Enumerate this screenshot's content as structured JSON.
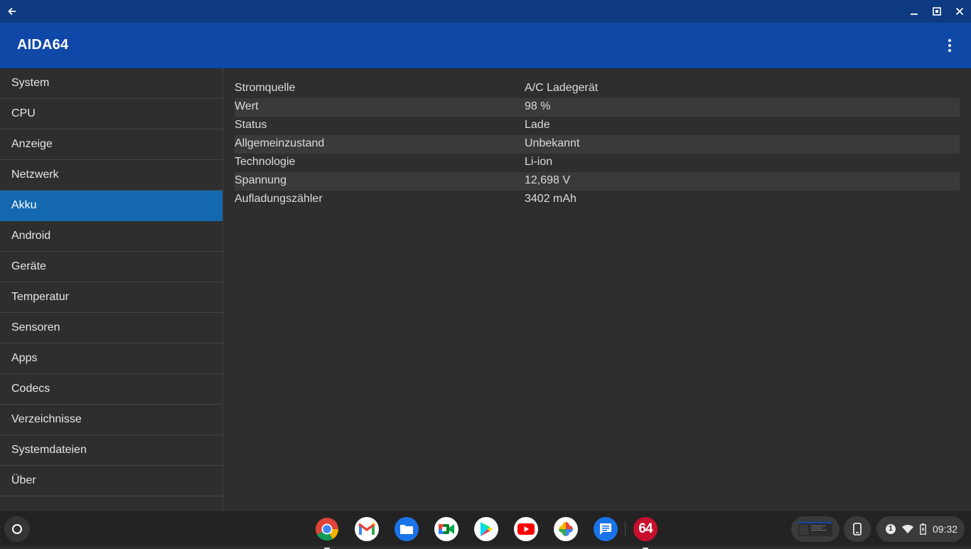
{
  "window": {
    "back_icon": "arrow-left-icon",
    "minimize_icon": "minimize-icon",
    "restore_icon": "restore-icon",
    "close_icon": "close-icon"
  },
  "appbar": {
    "title": "AIDA64",
    "menu_icon": "more-vertical-icon"
  },
  "sidebar": {
    "items": [
      {
        "label": "System"
      },
      {
        "label": "CPU"
      },
      {
        "label": "Anzeige"
      },
      {
        "label": "Netzwerk"
      },
      {
        "label": "Akku",
        "active": true
      },
      {
        "label": "Android"
      },
      {
        "label": "Geräte"
      },
      {
        "label": "Temperatur"
      },
      {
        "label": "Sensoren"
      },
      {
        "label": "Apps"
      },
      {
        "label": "Codecs"
      },
      {
        "label": "Verzeichnisse"
      },
      {
        "label": "Systemdateien"
      },
      {
        "label": "Über"
      }
    ],
    "active_color": "#1468b0"
  },
  "content": {
    "rows": [
      {
        "key": "Stromquelle",
        "value": "A/C Ladegerät"
      },
      {
        "key": "Wert",
        "value": "98 %"
      },
      {
        "key": "Status",
        "value": "Lade"
      },
      {
        "key": "Allgemeinzustand",
        "value": "Unbekannt"
      },
      {
        "key": "Technologie",
        "value": "Li-ion"
      },
      {
        "key": "Spannung",
        "value": "12,698 V"
      },
      {
        "key": "Aufladungszähler",
        "value": "3402 mAh"
      }
    ]
  },
  "shelf": {
    "launcher_icon": "launcher-circle-icon",
    "apps": [
      {
        "name": "chrome-icon",
        "running": true
      },
      {
        "name": "gmail-icon",
        "running": false
      },
      {
        "name": "files-icon",
        "running": false
      },
      {
        "name": "meet-icon",
        "running": false
      },
      {
        "name": "play-store-icon",
        "running": false
      },
      {
        "name": "youtube-icon",
        "running": false
      },
      {
        "name": "photos-icon",
        "running": false
      },
      {
        "name": "messages-icon",
        "running": false
      },
      {
        "name": "aida64-icon",
        "label": "64",
        "running": true
      }
    ],
    "tray": {
      "notification_count": "1",
      "wifi_icon": "wifi-icon",
      "battery_icon": "battery-charging-icon",
      "phone_hub_icon": "phone-icon",
      "time": "09:32"
    }
  },
  "colors": {
    "titlebar": "#0d3a80",
    "appbar": "#1048a8",
    "background": "#2e2e2e",
    "row_alt": "#3a3a3a"
  }
}
